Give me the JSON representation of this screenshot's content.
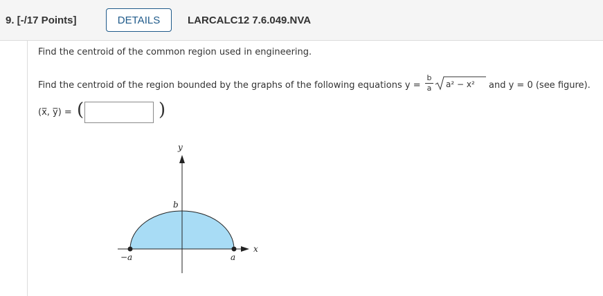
{
  "header": {
    "question_number": "9. [-/17 Points]",
    "details_label": "DETAILS",
    "problem_code": "LARCALC12 7.6.049.NVA"
  },
  "content": {
    "intro": "Find the centroid of the common region used in engineering.",
    "prompt_start": "Find the centroid of the region bounded by the graphs of the following equations y =",
    "frac_num": "b",
    "frac_den": "a",
    "radicand": "a² − x²",
    "prompt_end": "and y = 0 (see figure).",
    "centroid_label": "(x̅, y̅) =",
    "answer_value": "",
    "open_paren": "(",
    "close_paren": ")"
  },
  "figure": {
    "y_axis_label": "y",
    "x_axis_label": "x",
    "b_label": "b",
    "neg_a_label": "−a",
    "a_label": "a",
    "fill_color": "#a8dcf5",
    "stroke_color": "#222222"
  }
}
